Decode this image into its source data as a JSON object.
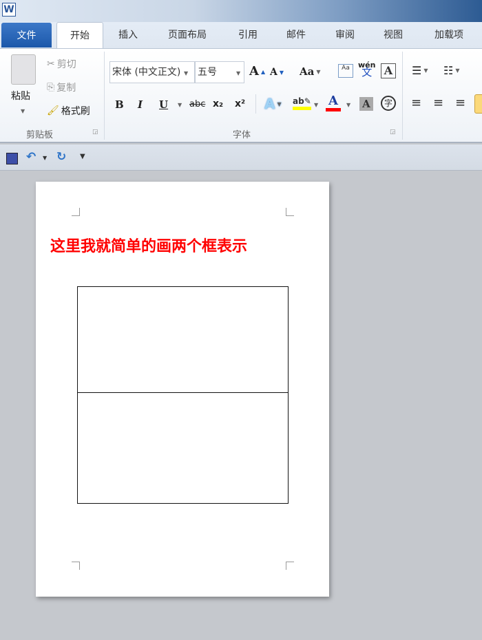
{
  "app": {
    "logo": "W"
  },
  "tabs": [
    "文件",
    "开始",
    "插入",
    "页面布局",
    "引用",
    "邮件",
    "审阅",
    "视图",
    "加载项"
  ],
  "clipboard": {
    "paste": "粘贴",
    "cut": "剪切",
    "copy": "复制",
    "format_painter": "格式刷",
    "label": "剪贴板"
  },
  "font": {
    "name": "宋体 (中文正文)",
    "size": "五号",
    "label": "字体",
    "change_case": "Aa",
    "wen": "wén",
    "wen_char": "文",
    "bold": "B",
    "italic": "I",
    "underline": "U",
    "strike": "abc",
    "sub": "x₂",
    "sup": "x²",
    "border_char": "A",
    "circle_char": "字"
  },
  "colors": {
    "highlight": "#ffff00",
    "font_color": "#ff0000",
    "heading": "#ff0000"
  },
  "document": {
    "heading": "这里我就简单的画两个框表示"
  }
}
